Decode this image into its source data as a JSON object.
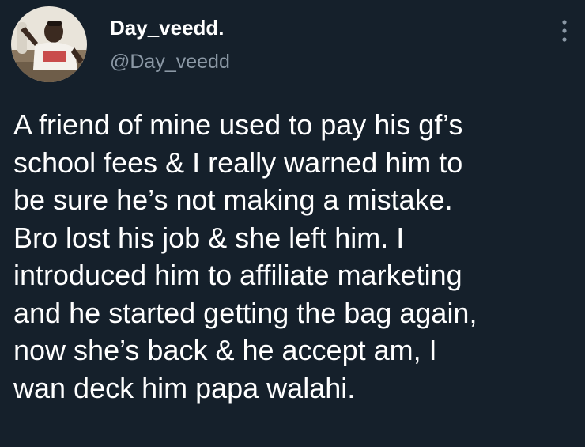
{
  "author": {
    "display_name": "Day_veedd.",
    "handle": "@Day_veedd",
    "avatar_icon": "profile-photo"
  },
  "menu": {
    "icon": "more-vertical-icon"
  },
  "tweet": {
    "lines": [
      "A friend of mine used to pay his gf’s",
      "school fees & I really warned him to",
      "be sure he’s not making a mistake.",
      "Bro lost his job & she left him. I",
      "introduced him to affiliate marketing",
      "and he started getting the bag again,",
      "now she’s back & he accept am, I",
      "wan deck him papa walahi."
    ]
  },
  "colors": {
    "background": "#15202b",
    "primary_text": "#ffffff",
    "secondary_text": "#8b98a5"
  }
}
